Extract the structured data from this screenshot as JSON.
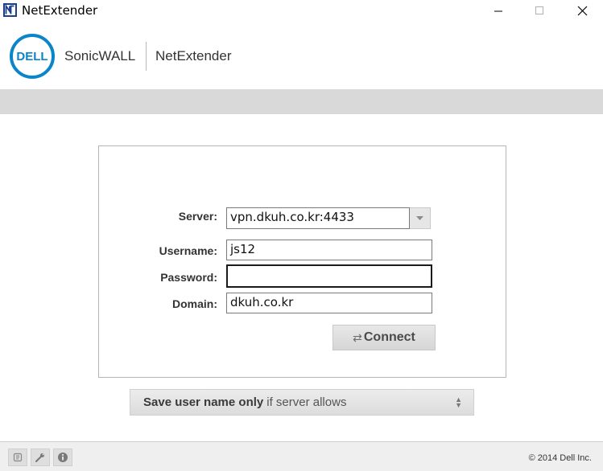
{
  "window": {
    "title": "NetExtender",
    "app_icon": "netextender-app-icon",
    "controls": [
      "minimize-icon",
      "maximize-icon",
      "close-icon"
    ]
  },
  "brand": {
    "dell_logo_text": "DELL",
    "product_line": "SonicWALL",
    "product_name": "NetExtender",
    "logo_color": "#0a85c9"
  },
  "form": {
    "server_label": "Server:",
    "server_value": "vpn.dkuh.co.kr:4433",
    "username_label": "Username:",
    "username_value": "js12",
    "password_label": "Password:",
    "password_value": "",
    "domain_label": "Domain:",
    "domain_value": "dkuh.co.kr",
    "connect_icon": "⇄",
    "connect_label": "Connect"
  },
  "save_option": {
    "bold_text": "Save user name only",
    "normal_text": "if server allows",
    "icon": "up-down-arrows-icon"
  },
  "statusbar": {
    "buttons": [
      "log-icon",
      "wrench-icon",
      "info-icon"
    ],
    "copyright": "© 2014 Dell Inc."
  }
}
